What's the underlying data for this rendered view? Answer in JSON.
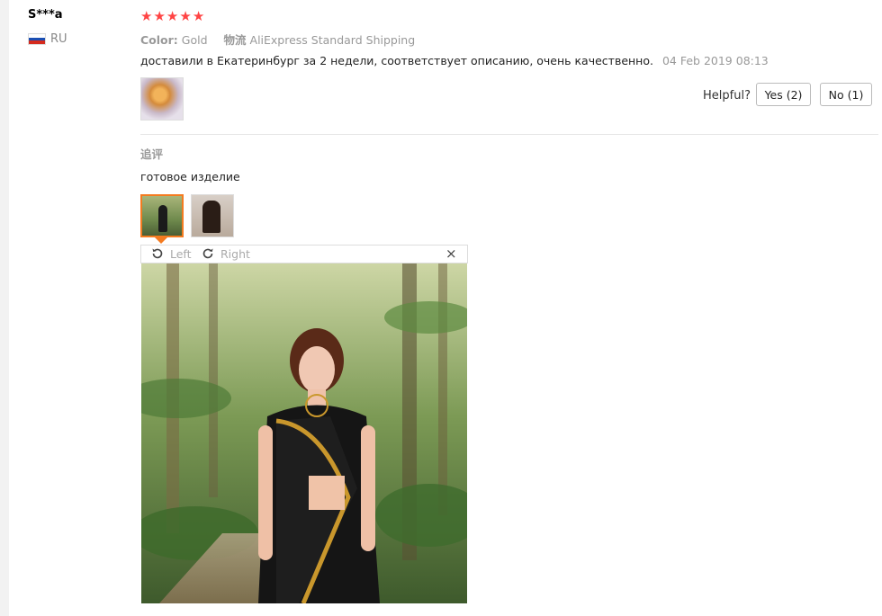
{
  "review": {
    "user": "S***a",
    "country": "RU",
    "rating": 5,
    "color_label": "Color:",
    "color_value": "Gold",
    "shipping_label": "物流",
    "shipping_value": "AliExpress Standard Shipping",
    "text": "доставили в Екатеринбург за 2 недели, соответствует описанию, очень качественно.",
    "date": "04 Feb 2019 08:13"
  },
  "helpful": {
    "label": "Helpful?",
    "yes": "Yes (2)",
    "no": "No (1)"
  },
  "followup": {
    "title": "追评",
    "text": "готовое изделие"
  },
  "viewer": {
    "rotate_left": "Left",
    "rotate_right": "Right",
    "close": "×"
  },
  "colors": {
    "star": "#ff4444",
    "accent": "#f47b20"
  }
}
